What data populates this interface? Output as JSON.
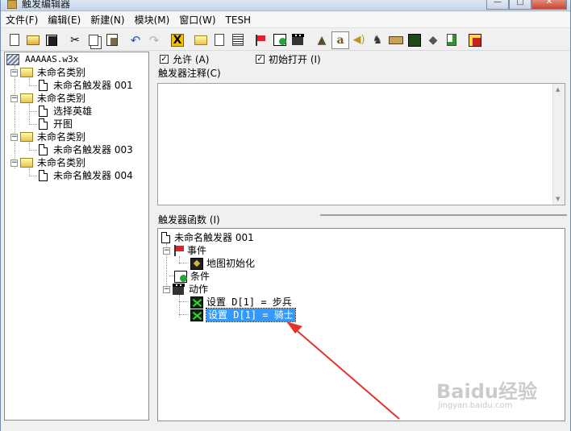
{
  "window": {
    "title": "触发编辑器",
    "minimize": "—",
    "maximize": "□",
    "close": "✕"
  },
  "menu": [
    "文件(F)",
    "编辑(E)",
    "新建(N)",
    "模块(M)",
    "窗口(W)",
    "TESH"
  ],
  "toolbar": {
    "icons": [
      "new-icon",
      "open-icon",
      "save-icon",
      "cut-icon",
      "copy-icon",
      "paste-icon",
      "undo-icon",
      "redo-icon",
      "delete-icon",
      "new-category-icon",
      "new-trigger-icon",
      "new-comment-icon",
      "new-event-icon",
      "new-condition-icon",
      "new-action-icon",
      "terrain-editor-icon",
      "trigger-editor-icon",
      "sound-editor-icon",
      "object-editor-icon",
      "campaign-editor-icon",
      "ai-editor-icon",
      "object-manager-icon",
      "import-manager-icon",
      "test-map-icon"
    ]
  },
  "left_tree": {
    "root": "AAAAAS.w3x",
    "categories": [
      {
        "label": "未命名类别",
        "triggers": [
          "未命名触发器 001"
        ]
      },
      {
        "label": "未命名类别",
        "triggers": [
          "选择英雄",
          "开图"
        ]
      },
      {
        "label": "未命名类别",
        "triggers": [
          "未命名触发器 003"
        ]
      },
      {
        "label": "未命名类别",
        "triggers": [
          "未命名触发器 004"
        ]
      }
    ]
  },
  "options": {
    "enabled_label": "允许 (A)",
    "enabled_checked": true,
    "initially_on_label": "初始打开 (I)",
    "initially_on_checked": true
  },
  "comment": {
    "label": "触发器注释(C)",
    "value": ""
  },
  "functions": {
    "label": "触发器函数 (I)",
    "trigger_name": "未命名触发器 001",
    "events_label": "事件",
    "event_items": [
      "地图初始化"
    ],
    "conditions_label": "条件",
    "actions_label": "动作",
    "action_items": [
      "设置 D[1] = 步兵",
      "设置 D[1] = 骑士"
    ]
  },
  "watermark": {
    "main": "Baidu经验",
    "sub": "jingyan.baidu.com"
  },
  "colors": {
    "selection": "#3399ff",
    "arrow": "#e5322d"
  }
}
